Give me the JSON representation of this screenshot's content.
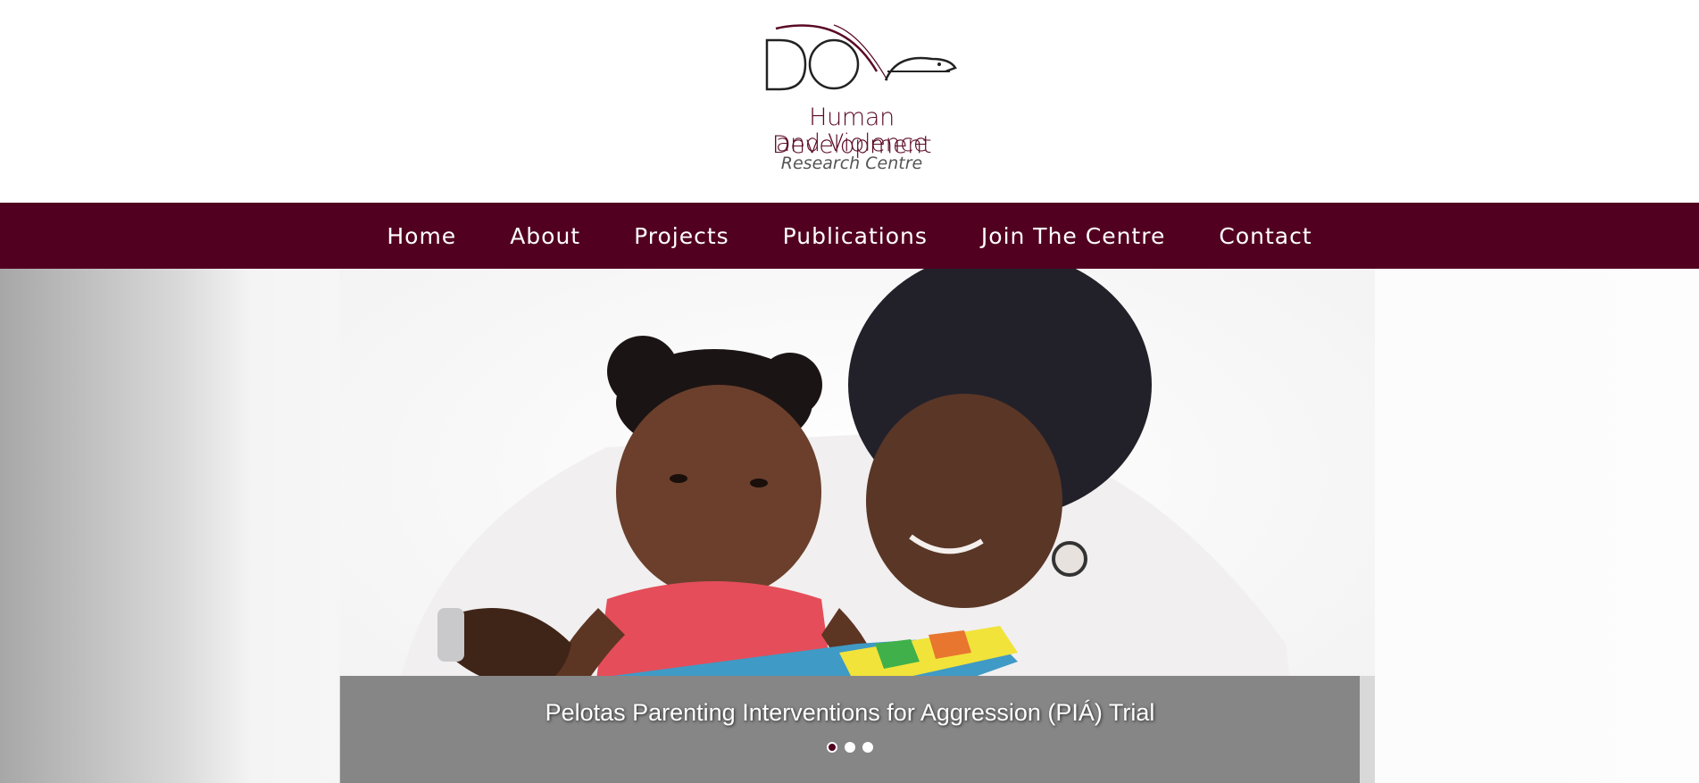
{
  "logo": {
    "wordmark": "DOVE",
    "line1": "Human Development",
    "line2": "and Violence",
    "line3": "Research Centre"
  },
  "nav": {
    "items": [
      {
        "label": "Home"
      },
      {
        "label": "About"
      },
      {
        "label": "Projects"
      },
      {
        "label": "Publications"
      },
      {
        "label": "Join The Centre"
      },
      {
        "label": "Contact"
      }
    ]
  },
  "hero": {
    "caption": "Pelotas Parenting Interventions for Aggression (PIÁ) Trial",
    "slides_total": 3,
    "active_slide": 1
  },
  "colors": {
    "brand": "#520020",
    "nav_text": "#ffffff"
  }
}
